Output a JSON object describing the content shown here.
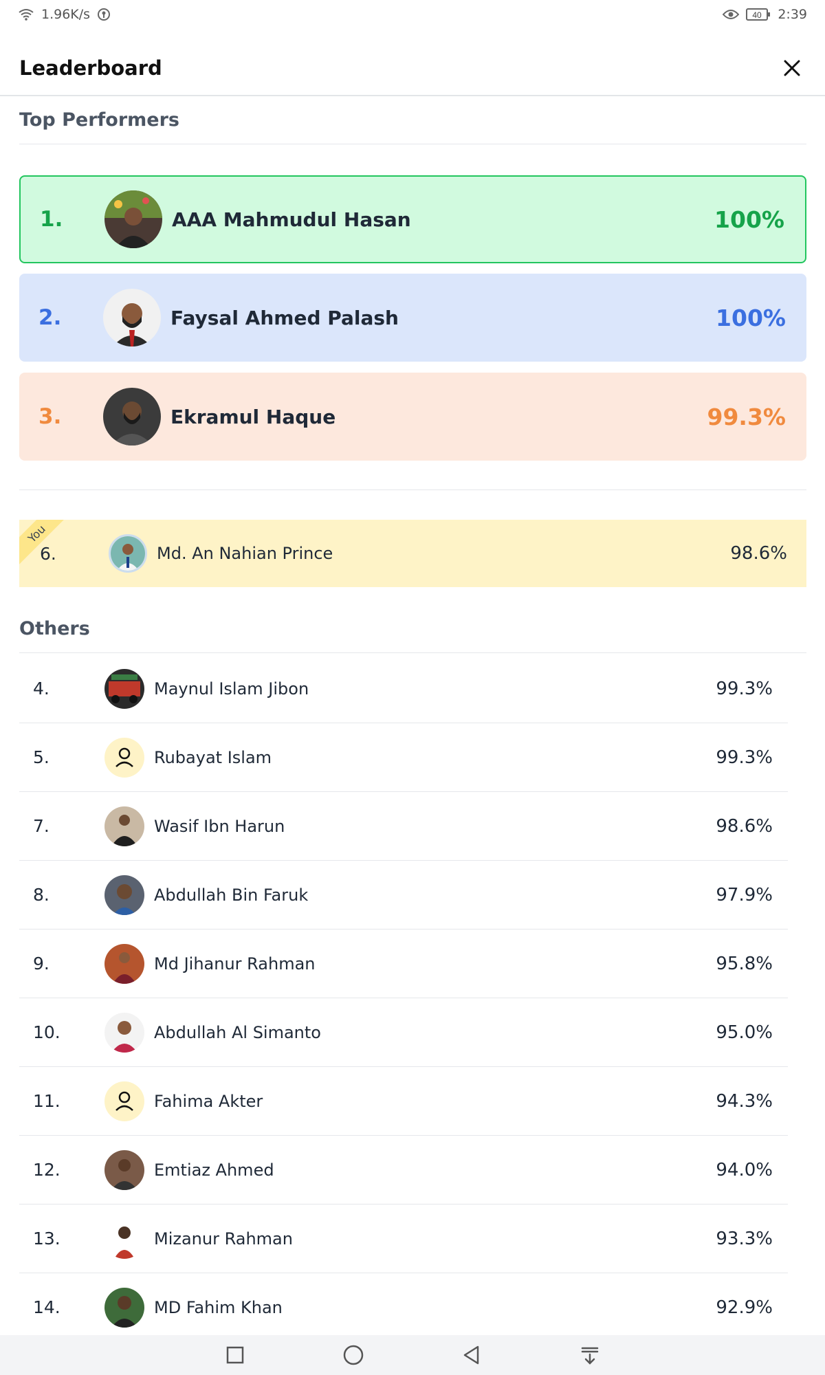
{
  "status_bar": {
    "net_speed": "1.96K/s",
    "battery": "40",
    "time": "2:39"
  },
  "header": {
    "title": "Leaderboard"
  },
  "top_performers": {
    "title": "Top Performers",
    "items": [
      {
        "rank": "1.",
        "name": "AAA Mahmudul Hasan",
        "score": "100%",
        "bg": "#d1fadf",
        "border": "#22c55e",
        "accent": "#16a34a"
      },
      {
        "rank": "2.",
        "name": "Faysal Ahmed Palash",
        "score": "100%",
        "bg": "#dbe6fb",
        "border": "#dbe6fb",
        "accent": "#3b6fe0"
      },
      {
        "rank": "3.",
        "name": "Ekramul Haque",
        "score": "99.3%",
        "bg": "#fde8dd",
        "border": "#fde8dd",
        "accent": "#f08a3e"
      }
    ]
  },
  "you": {
    "badge": "You",
    "rank": "6.",
    "name": "Md. An Nahian Prince",
    "score": "98.6%"
  },
  "others": {
    "title": "Others",
    "items": [
      {
        "rank": "4.",
        "name": "Maynul Islam Jibon",
        "score": "99.3%",
        "avatar": "photo"
      },
      {
        "rank": "5.",
        "name": "Rubayat Islam",
        "score": "99.3%",
        "avatar": "placeholder"
      },
      {
        "rank": "7.",
        "name": "Wasif Ibn Harun",
        "score": "98.6%",
        "avatar": "photo"
      },
      {
        "rank": "8.",
        "name": "Abdullah Bin Faruk",
        "score": "97.9%",
        "avatar": "photo"
      },
      {
        "rank": "9.",
        "name": "Md Jihanur Rahman",
        "score": "95.8%",
        "avatar": "photo"
      },
      {
        "rank": "10.",
        "name": "Abdullah Al Simanto",
        "score": "95.0%",
        "avatar": "photo"
      },
      {
        "rank": "11.",
        "name": "Fahima Akter",
        "score": "94.3%",
        "avatar": "placeholder"
      },
      {
        "rank": "12.",
        "name": "Emtiaz Ahmed",
        "score": "94.0%",
        "avatar": "photo"
      },
      {
        "rank": "13.",
        "name": "Mizanur Rahman",
        "score": "93.3%",
        "avatar": "photo"
      },
      {
        "rank": "14.",
        "name": "MD Fahim Khan",
        "score": "92.9%",
        "avatar": "photo"
      }
    ]
  }
}
